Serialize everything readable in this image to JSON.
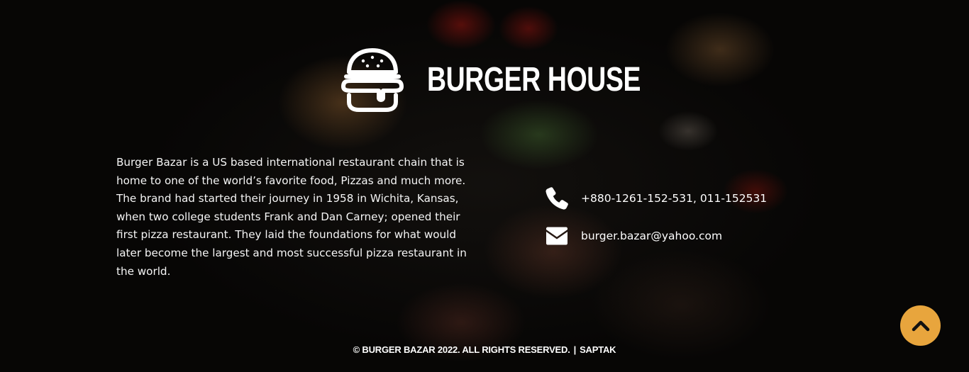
{
  "brand": {
    "logo_icon": "burger-icon",
    "name": "BURGER HOUSE"
  },
  "about": {
    "text": "Burger Bazar is a US based international restaurant chain that is home to one of the world’s favorite food, Pizzas and much more. The brand had started their journey in 1958 in Wichita, Kansas, when two college students Frank and Dan Carney; opened their first pizza restaurant. They laid the foundations for what would later become the largest and most successful pizza restaurant in the world."
  },
  "contact": {
    "phone_icon": "phone-icon",
    "phone": "+880-1261-152-531, 011-152531",
    "email_icon": "envelope-icon",
    "email": "burger.bazar@yahoo.com"
  },
  "footer": {
    "copyright": "© BURGER BAZAR 2022. ALL RIGHTS RESERVED.",
    "separator": "|",
    "author": "SAPTAK"
  },
  "scroll_top": {
    "icon": "chevron-up-icon",
    "color": "#e8a53d"
  }
}
